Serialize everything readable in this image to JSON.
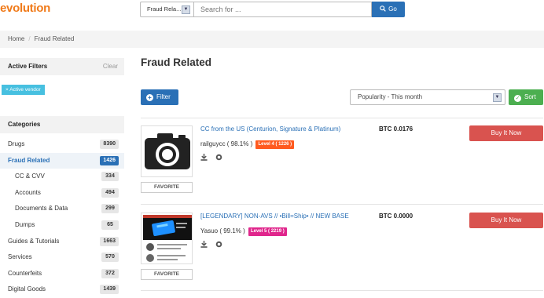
{
  "header": {
    "logo": "evolution",
    "category_select": "Fraud Rela...",
    "search_placeholder": "Search for ...",
    "go_label": "Go"
  },
  "breadcrumb": {
    "home": "Home",
    "separator": "/",
    "current": "Fraud Related"
  },
  "filters": {
    "title": "Active Filters",
    "clear": "Clear",
    "active_tag": "× Active vendor"
  },
  "categories": {
    "title": "Categories",
    "items": [
      {
        "label": "Drugs",
        "count": "8390"
      },
      {
        "label": "Fraud Related",
        "count": "1426"
      },
      {
        "label": "CC & CVV",
        "count": "334"
      },
      {
        "label": "Accounts",
        "count": "494"
      },
      {
        "label": "Documents & Data",
        "count": "299"
      },
      {
        "label": "Dumps",
        "count": "65"
      },
      {
        "label": "Guides & Tutorials",
        "count": "1663"
      },
      {
        "label": "Services",
        "count": "570"
      },
      {
        "label": "Counterfeits",
        "count": "372"
      },
      {
        "label": "Digital Goods",
        "count": "1439"
      }
    ]
  },
  "main": {
    "title": "Fraud Related",
    "filter_button": "Filter",
    "sort_select": "Popularity - This month",
    "sort_button": "Sort"
  },
  "listings": [
    {
      "title": "CC from the US (Centurion, Signature & Platinum)",
      "seller": "railguycc ( 98.1% )",
      "level": "Level 4 ( 1226 )",
      "level_color": "#ff5a1f",
      "price": "BTC 0.0176",
      "buy_label": "Buy It Now",
      "favorite_label": "FAVORITE"
    },
    {
      "title": "[LEGENDARY] NON-AVS // •Bill=Ship• // NEW BASE",
      "seller": "Yasuo ( 99.1% )",
      "level": "Level 5 ( 2219 )",
      "level_color": "#e0268c",
      "price": "BTC 0.0000",
      "buy_label": "Buy It Now",
      "favorite_label": "FAVORITE"
    }
  ],
  "colors": {
    "accent": "#2a70b6",
    "buy": "#d9534f",
    "sort": "#4caf50",
    "logo": "#f07a19"
  }
}
